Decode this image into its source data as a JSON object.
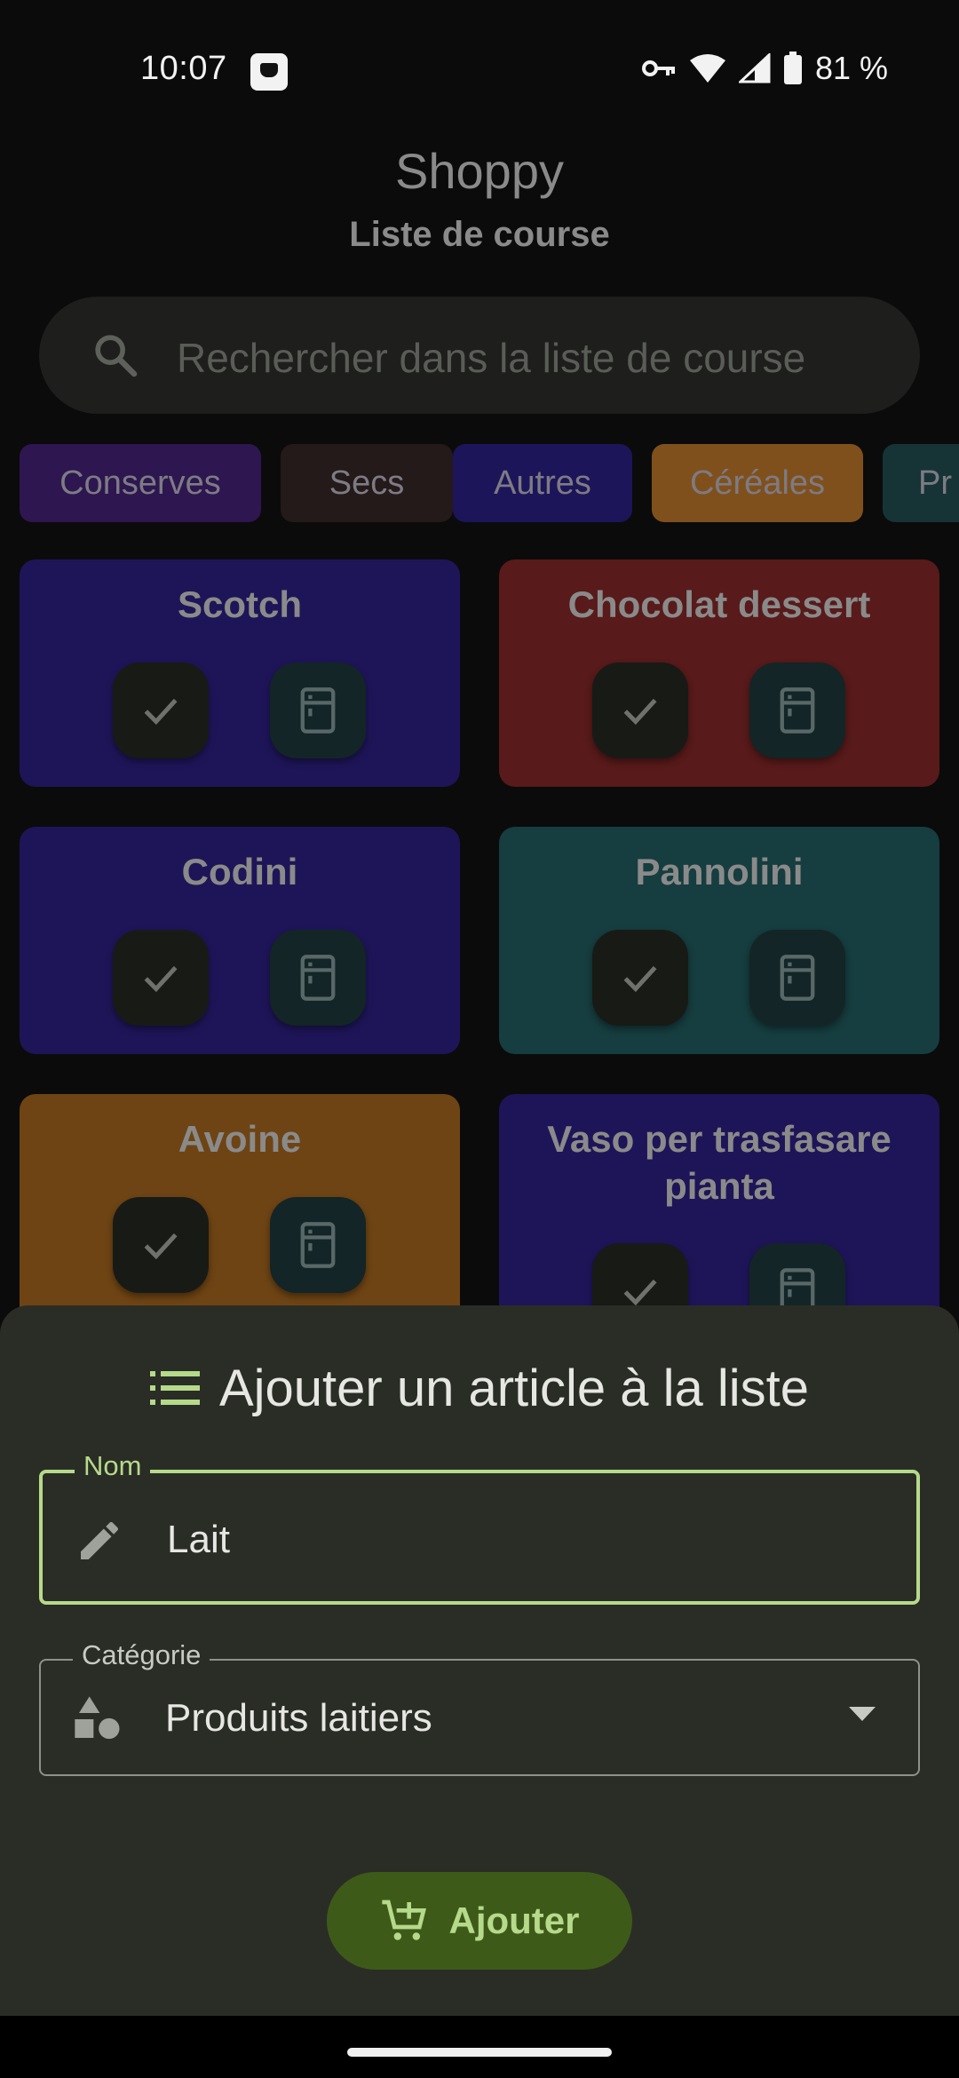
{
  "status_bar": {
    "time": "10:07",
    "battery": "81 %",
    "icons": [
      "notification-icon",
      "vpn-key-icon",
      "wifi-icon",
      "signal-icon",
      "battery-icon"
    ]
  },
  "header": {
    "title": "Shoppy",
    "subtitle": "Liste de course"
  },
  "search": {
    "placeholder": "Rechercher dans la liste de course",
    "icon": "search-icon"
  },
  "categories": [
    {
      "label": "Conserves",
      "color": "#2e1650"
    },
    {
      "label": "Secs",
      "color": "#241a19"
    },
    {
      "label": "Autres",
      "color": "#1d1559"
    },
    {
      "label": "Céréales",
      "color": "#80501c"
    },
    {
      "label": "Pr",
      "color": "#163436"
    }
  ],
  "items": [
    {
      "name": "Scotch",
      "color": "#1e1558"
    },
    {
      "name": "Chocolat dessert",
      "color": "#581a1a"
    },
    {
      "name": "Codini",
      "color": "#1e1558"
    },
    {
      "name": "Pannolini",
      "color": "#163d3f"
    },
    {
      "name": "Avoine",
      "color": "#6e4414"
    },
    {
      "name": "Vaso per trasfasare pianta",
      "color": "#1e1558"
    }
  ],
  "add_sheet": {
    "title": "Ajouter un article à la liste",
    "title_icon": "list-icon",
    "name_field": {
      "label": "Nom",
      "value": "Lait",
      "icon": "pencil-icon"
    },
    "category_field": {
      "label": "Catégorie",
      "value": "Produits laitiers",
      "icon": "shapes-icon"
    },
    "submit_label": "Ajouter",
    "submit_icon": "add-to-cart-icon"
  },
  "colors": {
    "accent": "#b6d98a",
    "button_bg": "#3e5a19",
    "sheet_bg": "#2a2d26"
  }
}
